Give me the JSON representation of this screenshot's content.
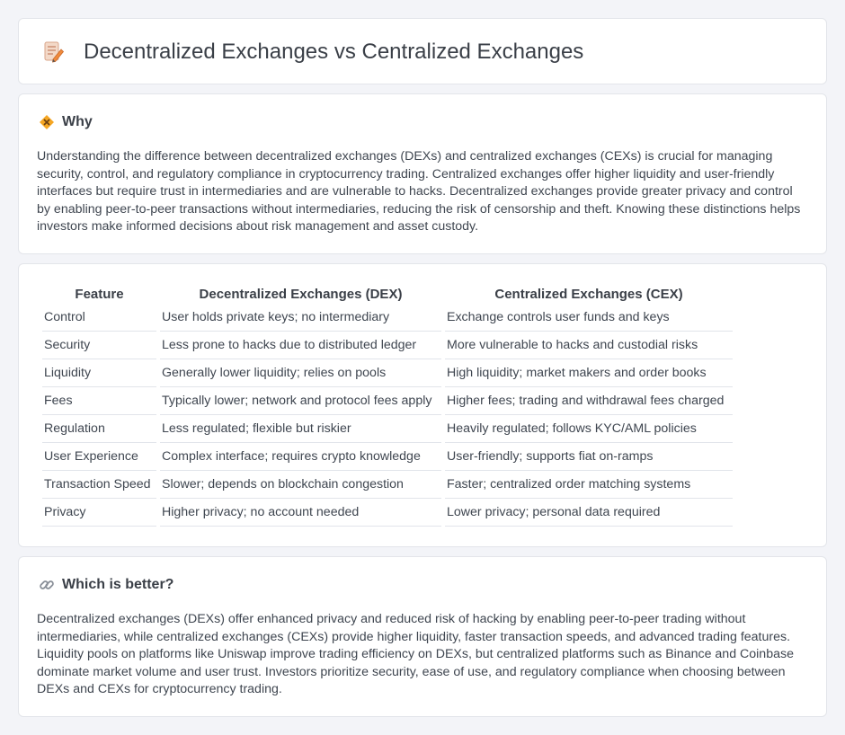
{
  "header": {
    "title": "Decentralized Exchanges vs Centralized Exchanges",
    "icon": "document-pencil-icon"
  },
  "why": {
    "title": "Why",
    "icon": "diamond-icon",
    "body": "Understanding the difference between decentralized exchanges (DEXs) and centralized exchanges (CEXs) is crucial for managing security, control, and regulatory compliance in cryptocurrency trading. Centralized exchanges offer higher liquidity and user-friendly interfaces but require trust in intermediaries and are vulnerable to hacks. Decentralized exchanges provide greater privacy and control by enabling peer-to-peer transactions without intermediaries, reducing the risk of censorship and theft. Knowing these distinctions helps investors make informed decisions about risk management and asset custody."
  },
  "comparison": {
    "columns": [
      "Feature",
      "Decentralized Exchanges (DEX)",
      "Centralized Exchanges (CEX)"
    ],
    "rows": [
      [
        "Control",
        "User holds private keys; no intermediary",
        "Exchange controls user funds and keys"
      ],
      [
        "Security",
        "Less prone to hacks due to distributed ledger",
        "More vulnerable to hacks and custodial risks"
      ],
      [
        "Liquidity",
        "Generally lower liquidity; relies on pools",
        "High liquidity; market makers and order books"
      ],
      [
        "Fees",
        "Typically lower; network and protocol fees apply",
        "Higher fees; trading and withdrawal fees charged"
      ],
      [
        "Regulation",
        "Less regulated; flexible but riskier",
        "Heavily regulated; follows KYC/AML policies"
      ],
      [
        "User Experience",
        "Complex interface; requires crypto knowledge",
        "User-friendly; supports fiat on-ramps"
      ],
      [
        "Transaction Speed",
        "Slower; depends on blockchain congestion",
        "Faster; centralized order matching systems"
      ],
      [
        "Privacy",
        "Higher privacy; no account needed",
        "Lower privacy; personal data required"
      ]
    ]
  },
  "better": {
    "title": "Which is better?",
    "icon": "link-icon",
    "body": "Decentralized exchanges (DEXs) offer enhanced privacy and reduced risk of hacking by enabling peer-to-peer trading without intermediaries, while centralized exchanges (CEXs) provide higher liquidity, faster transaction speeds, and advanced trading features. Liquidity pools on platforms like Uniswap improve trading efficiency on DEXs, but centralized platforms such as Binance and Coinbase dominate market volume and user trust. Investors prioritize security, ease of use, and regulatory compliance when choosing between DEXs and CEXs for cryptocurrency trading."
  }
}
